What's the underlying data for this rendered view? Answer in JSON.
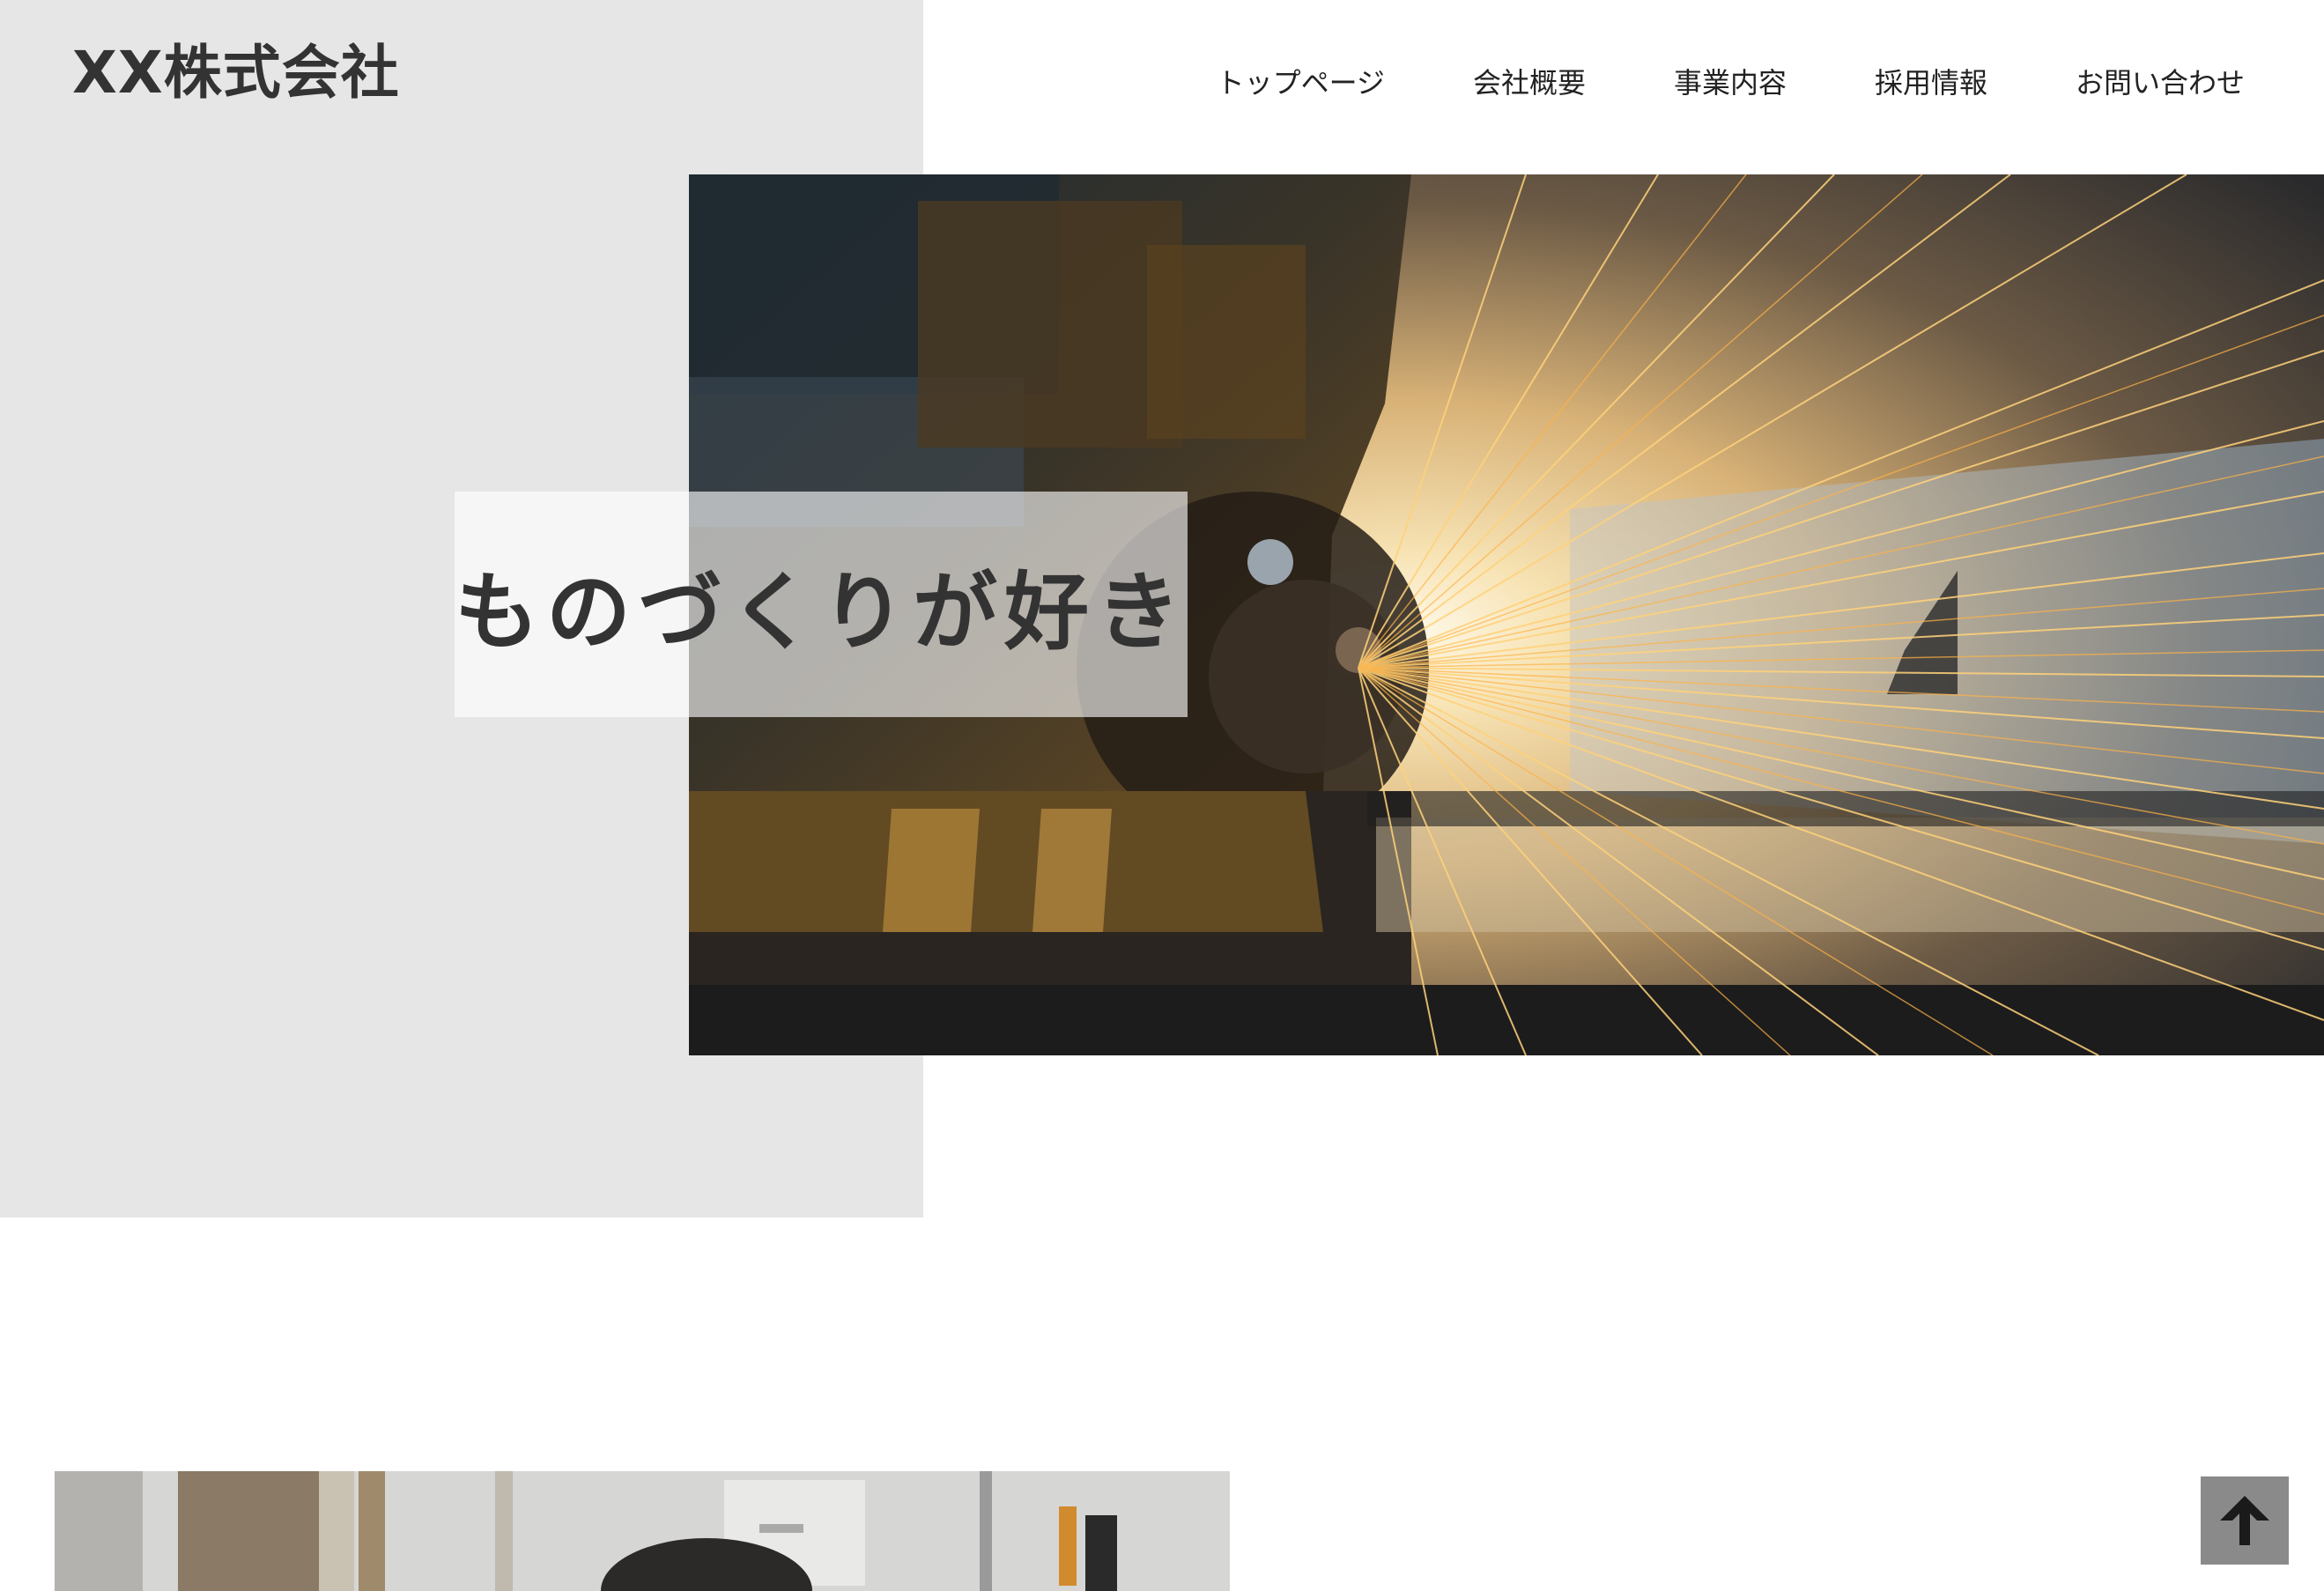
{
  "header": {
    "logo": "XX株式会社",
    "nav": [
      {
        "label": "トップページ"
      },
      {
        "label": "会社概要"
      },
      {
        "label": "事業内容"
      },
      {
        "label": "採用情報"
      },
      {
        "label": "お問い合わせ"
      }
    ]
  },
  "hero": {
    "catch_copy": "ものづくりが好き"
  },
  "back_to_top": {
    "icon": "arrow-up-icon"
  },
  "colors": {
    "panel": "#e6e6e6",
    "text": "#333333",
    "to_top_button": "#8a8a8a"
  }
}
